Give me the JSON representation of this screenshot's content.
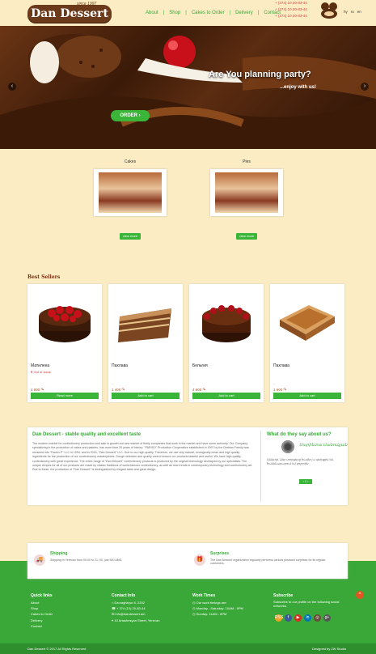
{
  "header": {
    "logo_text": "Dan Dessert",
    "logo_tagline": "since 1997",
    "nav": [
      "About",
      "Shop",
      "Cakes to Order",
      "Delivery",
      "Contact"
    ],
    "nav_separator": "|",
    "phones": [
      "+ (374) 10 20-83-44",
      "+ (374) 10 20-83-44",
      "+ (374) 10 20-83-44"
    ],
    "languages": [
      "hy",
      "ru",
      "en"
    ]
  },
  "hero": {
    "headline": "Are You planning party?",
    "subline": "...enjoy with us!",
    "order_button": "ORDER",
    "prev_arrow": "‹",
    "next_arrow": "›"
  },
  "categories": [
    {
      "title": "Cakes",
      "button": "view more"
    },
    {
      "title": "Pies",
      "button": "view more"
    }
  ],
  "best_sellers": {
    "title": "Best Sellers",
    "items": [
      {
        "name": "Матилена",
        "note": "♥ Out of stock",
        "dots": "...",
        "price": "4 000 ֏",
        "button": "Read more"
      },
      {
        "name": "Пахлава",
        "note": "",
        "dots": "...",
        "price": "1 400 ֏",
        "button": "Add to cart"
      },
      {
        "name": "Бельгия",
        "note": "",
        "dots": "...",
        "price": "4 600 ֏",
        "button": "Add to cart"
      },
      {
        "name": "Пахлава",
        "note": "",
        "dots": "...",
        "price": "1 600 ֏",
        "button": "Add to cart"
      }
    ]
  },
  "about": {
    "title": "Dan Dessert - stable quality and excellent taste",
    "text": "The modern market for confectionery production and sale is growth but new market of firmly companies that work in the market and have some authority. Our Company, specializing in the production of cakes and pastries, has more than 20 years of history. \"PARISO\" Production Cooperative established in 1997 by the Derbian Family was renamed into \"Daven-P\" LLC in 1994, and in 2015, \"Dan Dessert\" LLC. Due to our high quality. Therefore, we use only natural, ecologically clean and high quality ingredients for the production of our confectionery masterpieces. Dough selection and quality control ensure our products tasteful and useful. We have high quality confectionery with great experience. The entire range of \"Dan Dessert\" confectionery products is produced by the original technology developed by our specialists. The unique recipes for all of our products are made by classic traditions of world-famous confectionery, as well as new trends in contemporary technology and confectionery art. Due to these, the production of \"Dan Dessert\" is distinguished by elegant taste and great design."
  },
  "testimonials": {
    "title": "What do they say about us?",
    "name": "Մարիետա Մանուկյան",
    "text": "Անկեղծ, Ձեր տորթերը համեղ և գեղեցիկ են, հանձնարարում եմ բոլորին։",
    "pager": "‹ 1 ›"
  },
  "services": [
    {
      "icon": "🚚",
      "title": "Shipping",
      "text": "Shipping in Yerevan from 00:00 to 21, 00, just 500 AMD."
    },
    {
      "icon": "🎁",
      "title": "Surprises",
      "text": "The Dan Dessert organization regularly performs various pleasant surprises for its regular customers."
    }
  ],
  "footer": {
    "quick_links_title": "Quick links",
    "quick_links": [
      "About",
      "Shop",
      "Cakes to Order",
      "Delivery",
      "Contact"
    ],
    "contact_title": "Contact Info",
    "contact": [
      "Dzoraghbyur 8, 2202",
      "+ 374 (10) 20-83-44",
      "info@dandessert.am",
      "10 Artashesyan Street, Yerevan"
    ],
    "hours_title": "Work Times",
    "hours": [
      "Our work timings are:",
      "Monday - Saturday: 10AM - 9PM",
      "Sunday: 11AM - 8PM"
    ],
    "subscribe_title": "Subscribe",
    "subscribe_text": "Subscribe to our profile on the following social networks.",
    "socials": [
      {
        "label": "RSS",
        "color": "#f0a020"
      },
      {
        "label": "f",
        "color": "#3b5998"
      },
      {
        "label": "▶",
        "color": "#d62d20"
      },
      {
        "label": "in",
        "color": "#0077b5"
      },
      {
        "label": "◎",
        "color": "#6a4a3a"
      },
      {
        "label": "g+",
        "color": "#555"
      }
    ],
    "back_to_top": "^",
    "copyright": "Dan Dessert © 2017 All Rights Reserved",
    "designed": "Designed by ZW Studio"
  },
  "colors": {
    "accent": "#3ab53a",
    "background": "#fbecc4",
    "footer": "#3aa838"
  }
}
